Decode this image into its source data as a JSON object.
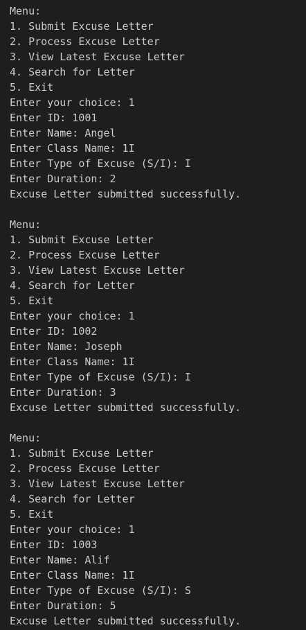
{
  "terminal": {
    "blocks": [
      {
        "lines": [
          "Menu:",
          "1. Submit Excuse Letter",
          "2. Process Excuse Letter",
          "3. View Latest Excuse Letter",
          "4. Search for Letter",
          "5. Exit",
          "Enter your choice: 1",
          "Enter ID: 1001",
          "Enter Name: Angel",
          "Enter Class Name: 1I",
          "Enter Type of Excuse (S/I): I",
          "Enter Duration: 2",
          "Excuse Letter submitted successfully."
        ]
      },
      {
        "lines": [
          "Menu:",
          "1. Submit Excuse Letter",
          "2. Process Excuse Letter",
          "3. View Latest Excuse Letter",
          "4. Search for Letter",
          "5. Exit",
          "Enter your choice: 1",
          "Enter ID: 1002",
          "Enter Name: Joseph",
          "Enter Class Name: 1I",
          "Enter Type of Excuse (S/I): I",
          "Enter Duration: 3",
          "Excuse Letter submitted successfully."
        ]
      },
      {
        "lines": [
          "Menu:",
          "1. Submit Excuse Letter",
          "2. Process Excuse Letter",
          "3. View Latest Excuse Letter",
          "4. Search for Letter",
          "5. Exit",
          "Enter your choice: 1",
          "Enter ID: 1003",
          "Enter Name: Alif",
          "Enter Class Name: 1I",
          "Enter Type of Excuse (S/I): S",
          "Enter Duration: 5",
          "Excuse Letter submitted successfully."
        ]
      }
    ]
  }
}
